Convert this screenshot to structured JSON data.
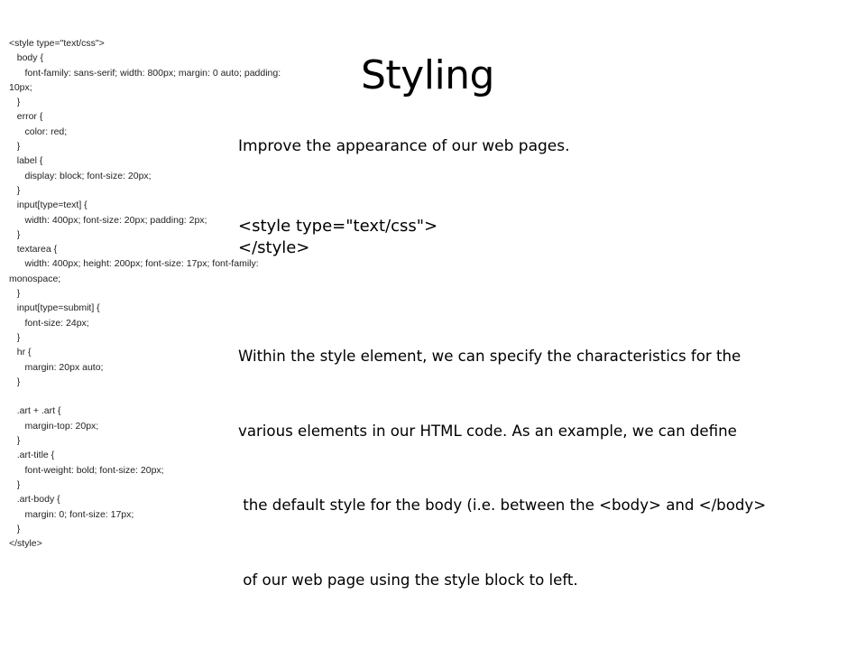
{
  "slide": {
    "title": "Styling",
    "intro": "Improve the appearance of our web pages.",
    "style_open_tag": "<style type=\"text/css\">",
    "style_close_tag": "</style>",
    "paragraph_lines": [
      "Within the style element, we can specify the characteristics for the",
      "various elements in our HTML code. As an example, we can define",
      " the default style for the body (i.e. between the <body> and </body>",
      " of our web page using the style block to left."
    ]
  },
  "code_lines": [
    "<style type=\"text/css\">",
    "   body {",
    "      font-family: sans-serif; width: 800px; margin: 0 auto; padding:",
    "10px;",
    "   }",
    "   error {",
    "      color: red;",
    "   }",
    "   label {",
    "      display: block; font-size: 20px;",
    "   }",
    "   input[type=text] {",
    "      width: 400px; font-size: 20px; padding: 2px;",
    "   }",
    "   textarea {",
    "      width: 400px; height: 200px; font-size: 17px; font-family:",
    "monospace;",
    "   }",
    "   input[type=submit] {",
    "      font-size: 24px;",
    "   }",
    "   hr {",
    "      margin: 20px auto;",
    "   }",
    "",
    "   .art + .art {",
    "      margin-top: 20px;",
    "   }",
    "   .art-title {",
    "      font-weight: bold; font-size: 20px;",
    "   }",
    "   .art-body {",
    "      margin: 0; font-size: 17px;",
    "   }",
    "</style>"
  ]
}
